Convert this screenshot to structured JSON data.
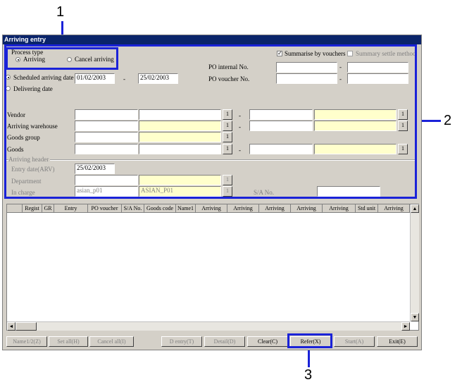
{
  "callouts": {
    "c1": "1",
    "c2": "2",
    "c3": "3"
  },
  "window": {
    "title": "Arriving entry"
  },
  "process_type": {
    "label": "Process type",
    "opt1": "Arriving",
    "opt2": "Cancel arriving",
    "selected": "Arriving"
  },
  "summarise": {
    "label": "Summarise by vouchers",
    "checked": true
  },
  "summary_settle": {
    "label": "Summary settle method",
    "checked": false
  },
  "po_internal": {
    "label": "PO internal No.",
    "dash": "-"
  },
  "po_voucher": {
    "label": "PO voucher No.",
    "dash": "-"
  },
  "date_mode": {
    "opt1": "Scheduled arriving date",
    "opt2": "Delivering date",
    "selected": "Scheduled arriving date"
  },
  "date_from": "01/02/2003",
  "date_dash": "-",
  "date_to": "25/02/2003",
  "range_rows": {
    "vendor": "Vendor",
    "warehouse": "Arriving warehouse",
    "goods_group": "Goods group",
    "goods": "Goods",
    "btn": "1",
    "dash": "-"
  },
  "header": {
    "title": "Arriving header",
    "entry_date_label": "Entry date(ARV)",
    "entry_date": "25/02/2003",
    "department_label": "Department",
    "incharge_label": "In charge",
    "incharge_code": "asian_p01",
    "incharge_name": "ASIAN_P01",
    "sa_label": "S/A No."
  },
  "grid_columns": [
    "",
    "Regist",
    "GR",
    "Entry",
    "PO voucher",
    "S/A No.",
    "Goods code",
    "Name1",
    "Arriving",
    "Arriving",
    "Arriving",
    "Arriving",
    "Arriving",
    "Std unit",
    "Arriving"
  ],
  "buttons": {
    "name12": "Name1/2(Z)",
    "set_all": "Set all(H)",
    "cancel_all": "Cancel all(I)",
    "d_entry": "D entry(T)",
    "detail": "Detail(D)",
    "clear": "Clear(C)",
    "refer": "Refer(X)",
    "start": "Start(A)",
    "exit": "Exit(E)"
  }
}
